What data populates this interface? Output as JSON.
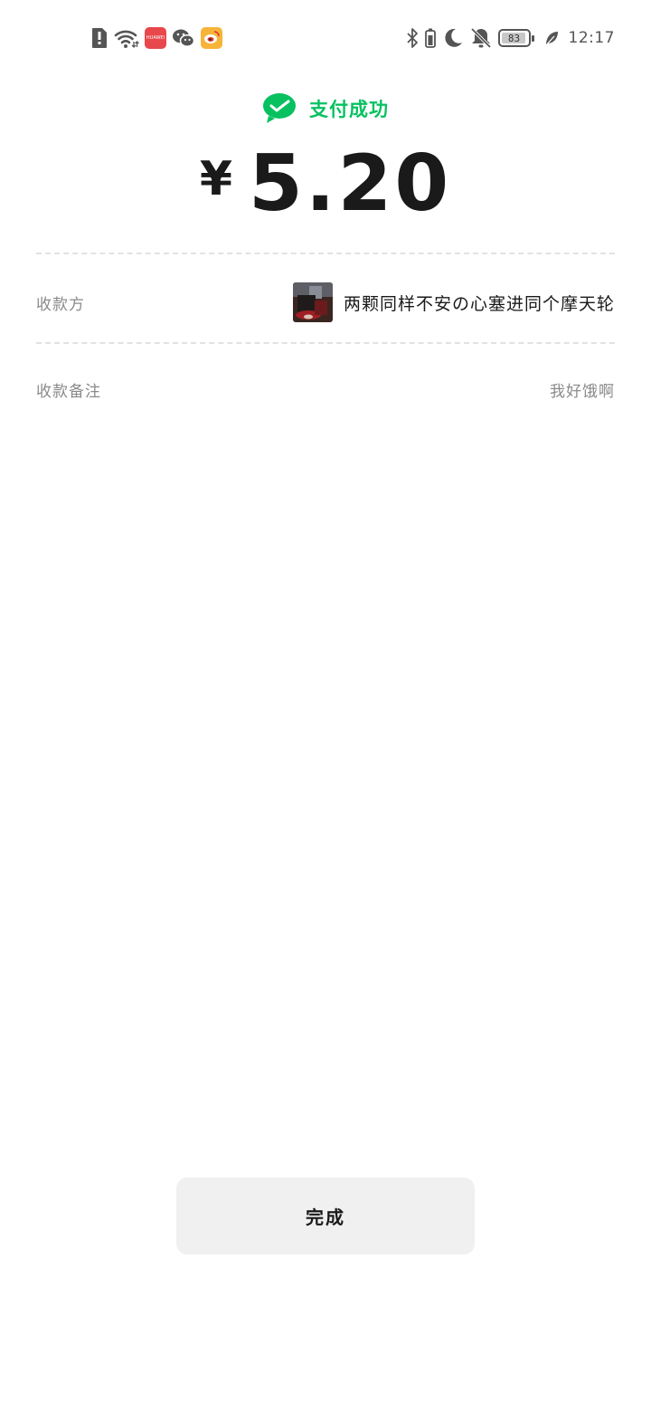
{
  "status_bar": {
    "left_icons": [
      "alert-sim-icon",
      "wifi-icon",
      "huawei-appgallery-icon",
      "wechat-icon",
      "weibo-icon"
    ],
    "huawei_badge_text": "HUAWEI",
    "right_icons": [
      "bluetooth-icon",
      "vibrate-battery-icon",
      "moon-icon",
      "bell-off-icon",
      "battery-icon",
      "leaf-icon"
    ],
    "battery_level": "83",
    "time": "12:17"
  },
  "payment": {
    "status_text": "支付成功",
    "currency_symbol": "¥",
    "amount": "5.20"
  },
  "details": {
    "payee_label": "收款方",
    "payee_name": "两颗同样不安の心塞进同个摩天轮",
    "remark_label": "收款备注",
    "remark_value": "我好饿啊"
  },
  "actions": {
    "done_label": "完成"
  },
  "colors": {
    "brand_green": "#07c160",
    "button_bg": "#f0f0f0",
    "label_gray": "#8a8a8a",
    "text_dark": "#1a1a1a"
  }
}
